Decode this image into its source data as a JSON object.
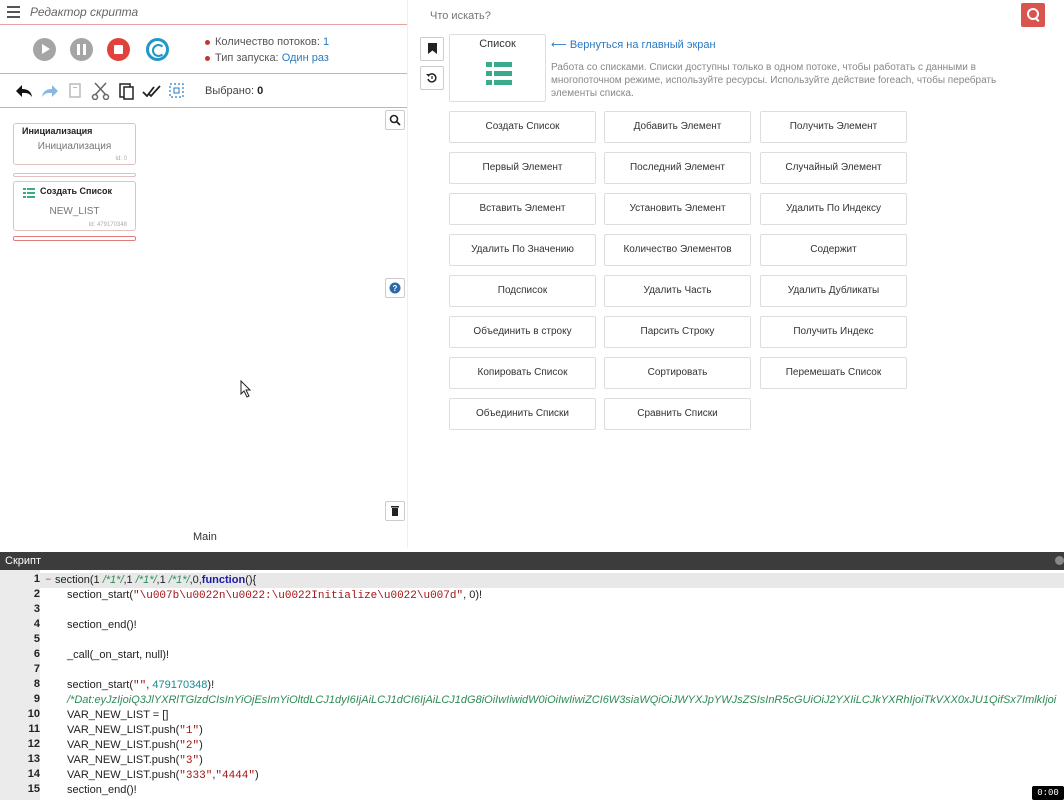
{
  "editor": {
    "title": "Редактор скрипта"
  },
  "run_info": {
    "threads_label": "Количество потоков:",
    "threads_value": "1",
    "launch_label": "Тип запуска:",
    "launch_value": "Один раз"
  },
  "toolbar": {
    "selected_label": "Выбрано:",
    "selected_value": "0"
  },
  "blocks": [
    {
      "title": "Инициализация",
      "body": "Инициализация",
      "id": "Id: 0"
    },
    {
      "title": "Создать Список",
      "body": "NEW_LIST",
      "id": "Id: 479170348"
    }
  ],
  "tabs": {
    "main": "Main"
  },
  "search": {
    "placeholder": "Что искать?"
  },
  "category": {
    "card_title": "Список",
    "back_link": "Вернуться на главный экран",
    "description": "Работа со списками. Списки доступны только в одном потоке, чтобы работать с данными в многопоточном режиме, используйте ресурсы. Используйте действие foreach, чтобы перебрать элементы списка."
  },
  "actions": [
    "Создать Список",
    "Добавить Элемент",
    "Получить Элемент",
    "Первый Элемент",
    "Последний Элемент",
    "Случайный Элемент",
    "Вставить Элемент",
    "Установить Элемент",
    "Удалить По Индексу",
    "Удалить По Значению",
    "Количество Элементов",
    "Содержит",
    "Подсписок",
    "Удалить Часть",
    "Удалить Дубликаты",
    "Объединить в строку",
    "Парсить Строку",
    "Получить Индекс",
    "Копировать Список",
    "Сортировать",
    "Перемешать Список",
    "Объединить Списки",
    "Сравнить Списки"
  ],
  "script_panel": {
    "title": "Скрипт",
    "lines": [
      "section(1 /*1*/,1 /*1*/,1 /*1*/,0,function(){",
      "section_start(\"\\u007b\\u0022n\\u0022:\\u0022Initialize\\u0022\\u007d\", 0)!",
      "",
      "section_end()!",
      "",
      "_call(_on_start, null)!",
      "",
      "section_start(\"\", 479170348)!",
      "/*Dat:eyJzIjoiQ3JlYXRlTGlzdCIsInYiOjEsImYiOltdLCJ1dyI6IjAiLCJ1dCI6IjAiLCJ1dG8iOiIwIiwidW0iOiIwIiwiZCI6W3siaWQiOiJWYXJpYWJsZSIsInR5cGUiOiJ2YXIiLCJkYXRhIjoiTkVXX0xJU1QifSx7ImlkIjoi",
      "VAR_NEW_LIST = []",
      "VAR_NEW_LIST.push(\"1\")",
      "VAR_NEW_LIST.push(\"2\")",
      "VAR_NEW_LIST.push(\"3\")",
      "VAR_NEW_LIST.push(\"333\",\"4444\")",
      "section_end()!"
    ]
  },
  "timer": "0:00",
  "colors": {
    "accent_red": "#d9534f",
    "link_blue": "#2a7ac0",
    "stop_red": "#e0413a",
    "restart_blue": "#2196c9"
  },
  "icons": [
    "menu-icon",
    "play-icon",
    "pause-icon",
    "stop-icon",
    "restart-icon",
    "undo-icon",
    "redo-icon",
    "copy-icon",
    "cut-icon",
    "paste-icon",
    "check-all-icon",
    "select-icon",
    "search-icon",
    "help-icon",
    "trash-icon",
    "bookmark-icon",
    "history-icon",
    "list-icon",
    "back-arrow-icon"
  ]
}
